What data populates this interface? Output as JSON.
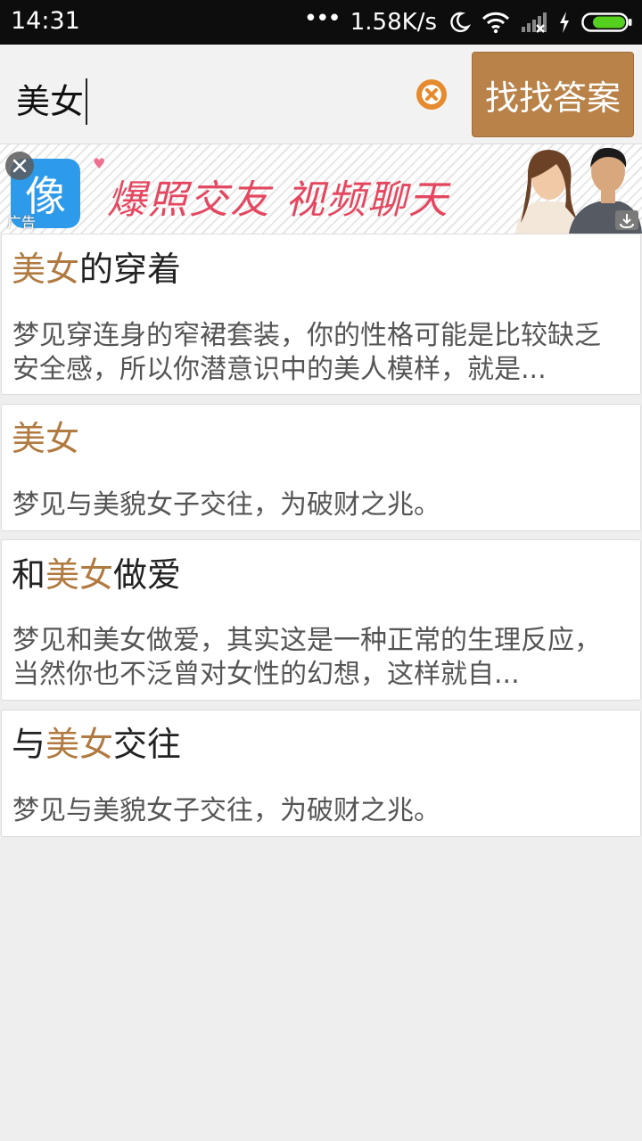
{
  "status_bar": {
    "time": "14:31",
    "dots": "•••",
    "speed": "1.58K/s",
    "icons": [
      "moon-icon",
      "wifi-icon",
      "signal-icon",
      "charging-icon",
      "battery-icon"
    ],
    "battery_color": "#55d01f"
  },
  "search": {
    "query": "美女",
    "button_label": "找找答案",
    "accent": "#b98249"
  },
  "ad": {
    "logo_glyph": "像",
    "tag": "广告",
    "slogan": "爆照交友 视频聊天"
  },
  "results": [
    {
      "title_before": "",
      "title_highlight": "美女",
      "title_after": "的穿着",
      "description": "梦见穿连身的窄裙套装，你的性格可能是比较缺乏安全感，所以你潜意识中的美人模样，就是..."
    },
    {
      "title_before": "",
      "title_highlight": "美女",
      "title_after": "",
      "description": "梦见与美貌女子交往，为破财之兆。"
    },
    {
      "title_before": "和",
      "title_highlight": "美女",
      "title_after": "做爱",
      "description": "梦见和美女做爱，其实这是一种正常的生理反应，当然你也不泛曾对女性的幻想，这样就自..."
    },
    {
      "title_before": "与",
      "title_highlight": "美女",
      "title_after": "交往",
      "description": "梦见与美貌女子交往，为破财之兆。"
    }
  ]
}
